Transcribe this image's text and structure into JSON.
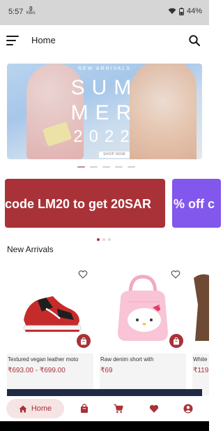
{
  "status_bar": {
    "time": "5:57",
    "net_speed_value": "0",
    "net_speed_unit": "KB/s",
    "battery": "44%"
  },
  "app_bar": {
    "title": "Home",
    "menu_icon": "menu-icon",
    "search_icon": "search-icon"
  },
  "banner": {
    "subtitle": "NEW ARRIVALS",
    "line1": "SUM",
    "line2": "MER",
    "line3": "2022",
    "button": "SHOP NOW",
    "dots_count": 5,
    "active_dot": 0
  },
  "promos": [
    {
      "text": "code LM20 to get 20SAR",
      "color": "#a83237"
    },
    {
      "text": "% off c",
      "color": "#8257ec"
    }
  ],
  "promo_dots": {
    "count": 3,
    "active": 0
  },
  "new_arrivals": {
    "title": "New Arrivals",
    "items": [
      {
        "name": "Textured vegan leather moto",
        "price": "₹693.00 - ₹699.00"
      },
      {
        "name": "Raw denim short with",
        "price": "₹69"
      },
      {
        "name": "White",
        "price": "₹119"
      }
    ]
  },
  "bottom_nav": {
    "home_label": "Home",
    "items": [
      "home-icon",
      "bag-icon",
      "cart-icon",
      "heart-icon",
      "account-icon"
    ]
  },
  "colors": {
    "accent": "#a83237",
    "promo_secondary": "#8257ec",
    "status_bar": "#d6d6d6"
  }
}
